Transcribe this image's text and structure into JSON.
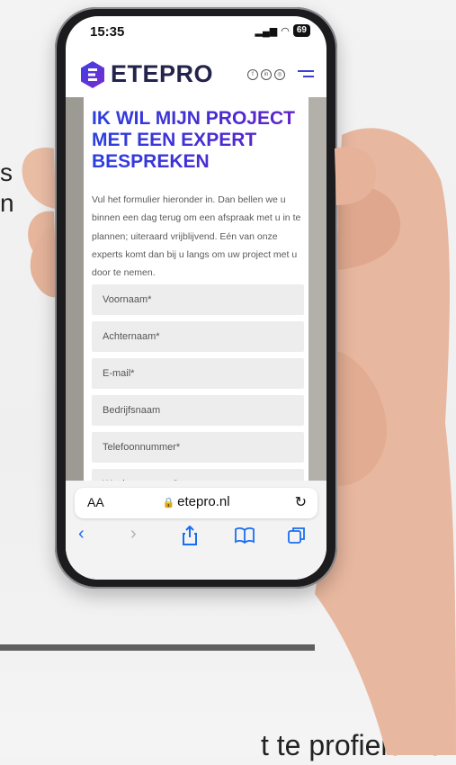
{
  "background": {
    "left_letters": [
      "s",
      "n"
    ],
    "bottom_text": "t te profielen of ontw"
  },
  "status_bar": {
    "time": "15:35",
    "battery": "69"
  },
  "header": {
    "logo_text": "ETEPRO",
    "social_icons": [
      "facebook-icon",
      "linkedin-icon",
      "instagram-icon"
    ],
    "menu_icon": "menu-icon"
  },
  "main": {
    "headline": "IK WIL MIJN PROJECT MET EEN EXPERT BESPREKEN",
    "intro": "Vul het formulier hieronder in. Dan bellen we u binnen een dag terug om een afspraak met u in te plannen; uiteraard vrijblijvend. Eén van onze experts komt dan bij u langs om uw project met u door te nemen.",
    "fields": [
      {
        "placeholder": "Voornaam*"
      },
      {
        "placeholder": "Achternaam*"
      },
      {
        "placeholder": "E-mail*"
      },
      {
        "placeholder": "Bedrijfsnaam"
      },
      {
        "placeholder": "Telefoonnummer*"
      },
      {
        "placeholder": "Wat is uw vraag?"
      }
    ]
  },
  "browser": {
    "aa_label": "AA",
    "url": "etepro.nl",
    "nav": [
      "back-icon",
      "forward-icon",
      "share-icon",
      "bookmarks-icon",
      "tabs-icon"
    ]
  },
  "colors": {
    "brand_blue": "#2b3fe0",
    "brand_purple": "#6a20c8",
    "safari_blue": "#1a6df2"
  }
}
